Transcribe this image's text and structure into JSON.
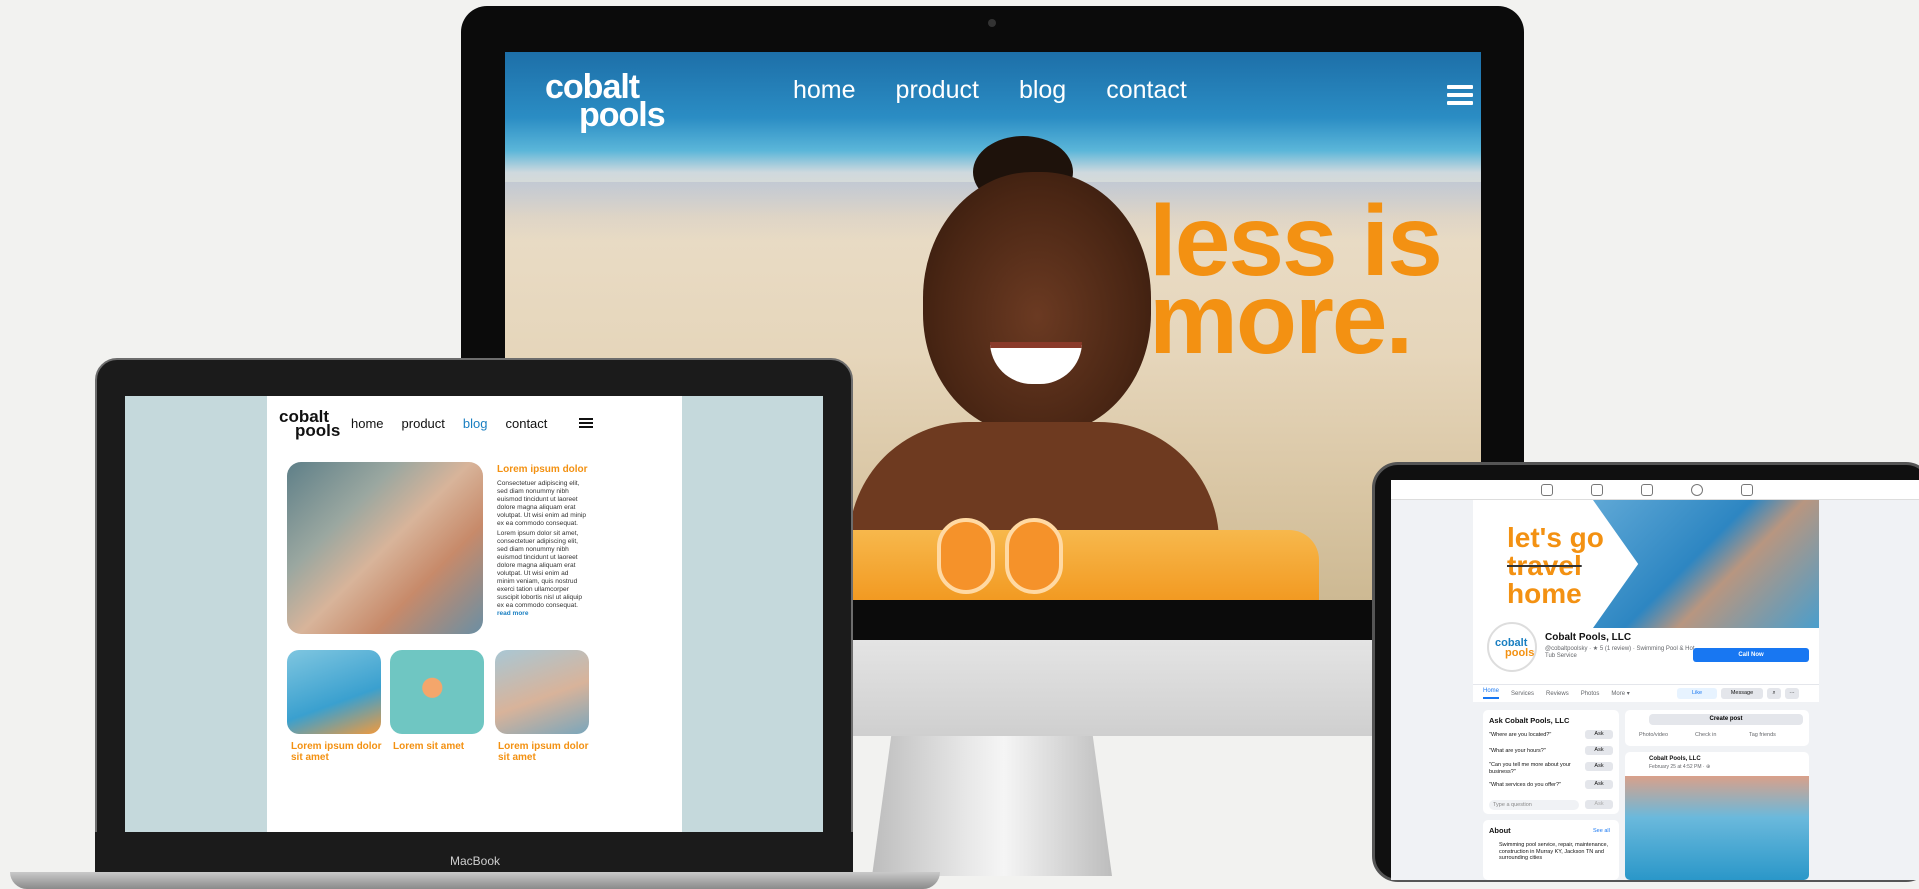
{
  "imac": {
    "logo_line1": "cobalt",
    "logo_line2": "pools",
    "nav": [
      "home",
      "product",
      "blog",
      "contact"
    ],
    "headline_line1": "less is",
    "headline_line2": "more."
  },
  "macbook": {
    "label": "MacBook",
    "logo_line1": "cobalt",
    "logo_line2": "pools",
    "nav": [
      "home",
      "product",
      "blog",
      "contact"
    ],
    "active_nav": "blog",
    "article_title": "Lorem ipsum dolor",
    "paragraph1": "Consectetuer adipiscing elit, sed diam nonummy nibh euismod tincidunt ut laoreet dolore magna aliquam erat volutpat. Ut wisi enim ad minip ex ea commodo consequat.",
    "paragraph2": "Lorem ipsum dolor sit amet, consectetuer adipiscing elit, sed diam nonummy nibh euismod tincidunt ut laoreet dolore magna aliquam erat volutpat. Ut wisi enim ad minim veniam, quis nostrud exerci tation ullamcorper suscipit lobortis nisl ut aliquip ex ea commodo consequat.",
    "read_more": "read more",
    "captions": [
      "Lorem ipsum dolor sit amet",
      "Lorem sit amet",
      "Lorem ipsum dolor sit amet"
    ]
  },
  "ipad": {
    "cover_line1": "let's go",
    "cover_line2": "travel",
    "cover_line3": "home",
    "avatar_line1": "cobalt",
    "avatar_line2": "pools",
    "page_name": "Cobalt Pools, LLC",
    "page_sub": "@cobaltpoolsky · ★ 5 (1 review) · Swimming Pool & Hot Tub Service",
    "call_now": "Call Now",
    "tabs": [
      "Home",
      "Services",
      "Reviews",
      "Photos",
      "More ▾"
    ],
    "like": "Like",
    "message": "Message",
    "ask_title": "Ask Cobalt Pools, LLC",
    "questions": [
      "\"Where are you located?\"",
      "\"What are your hours?\"",
      "\"Can you tell me more about your business?\"",
      "\"What services do you offer?\""
    ],
    "ask_label": "Ask",
    "question_placeholder": "Type a question",
    "about_title": "About",
    "see_all": "See all",
    "about_text": "Swimming pool service, repair, maintenance, construction in Murray KY, Jackson TN and surrounding cities",
    "create_post": "Create post",
    "photo_video": "Photo/video",
    "check_in": "Check in",
    "tag_friends": "Tag friends",
    "feed_name": "Cobalt Pools, LLC",
    "feed_date": "February 25 at 4:52 PM · ⊕"
  },
  "colors": {
    "brand_orange": "#f39112",
    "brand_blue": "#1a7fc1",
    "facebook_blue": "#1877f2"
  }
}
